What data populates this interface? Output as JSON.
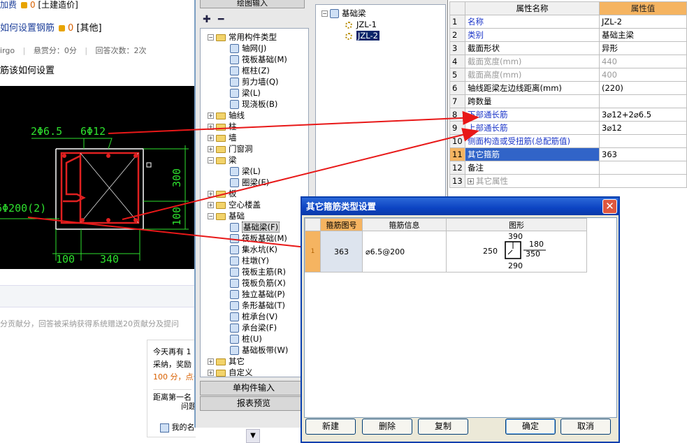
{
  "web": {
    "line1_text": "加费",
    "line1_count": "0",
    "line1_tag": "[土建造价]",
    "line2_link": "如何设置钢筋",
    "line2_count": "0",
    "line2_tag": "[其他]",
    "meta_user": "irgo",
    "meta_bounty": "悬赏分：0分",
    "meta_answers": "回答次数：2次",
    "question": "筋该如何设置",
    "cad_labels": [
      "2Φ6.5",
      "6Φ12",
      "6Φ200(2)",
      "300",
      "100",
      "100",
      "340"
    ],
    "note": "分贡献分，回答被采纳获得系统赠送20贡献分及提问",
    "box_lines": [
      "今天再有 1",
      "采纳，奖励",
      "100 分，点击"
    ],
    "box_lines2": [
      "距离第一名",
      "问题"
    ],
    "box_footer": "我的名",
    "scroll_glyph": "▼"
  },
  "app": {
    "draw_input_tab": "绘图输入",
    "toolbar": {
      "add_icon": "✚",
      "remove_icon": "━"
    },
    "tree": [
      {
        "label": "常用构件类型",
        "kind": "folder",
        "pm": "-"
      },
      {
        "label": "轴网(J)",
        "kind": "item"
      },
      {
        "label": "筏板基础(M)",
        "kind": "item"
      },
      {
        "label": "框柱(Z)",
        "kind": "item"
      },
      {
        "label": "剪力墙(Q)",
        "kind": "item"
      },
      {
        "label": "梁(L)",
        "kind": "item"
      },
      {
        "label": "现浇板(B)",
        "kind": "item"
      },
      {
        "label": "轴线",
        "kind": "folder",
        "pm": "+"
      },
      {
        "label": "柱",
        "kind": "folder",
        "pm": "+"
      },
      {
        "label": "墙",
        "kind": "folder",
        "pm": "+"
      },
      {
        "label": "门窗洞",
        "kind": "folder",
        "pm": "+"
      },
      {
        "label": "梁",
        "kind": "folder",
        "pm": "-"
      },
      {
        "label": "梁(L)",
        "kind": "item"
      },
      {
        "label": "圈梁(E)",
        "kind": "item"
      },
      {
        "label": "板",
        "kind": "folder",
        "pm": "+"
      },
      {
        "label": "空心楼盖",
        "kind": "folder",
        "pm": "+"
      },
      {
        "label": "基础",
        "kind": "folder",
        "pm": "-"
      },
      {
        "label": "基础梁(F)",
        "kind": "item",
        "selected": true
      },
      {
        "label": "筏板基础(M)",
        "kind": "item"
      },
      {
        "label": "集水坑(K)",
        "kind": "item"
      },
      {
        "label": "柱墩(Y)",
        "kind": "item"
      },
      {
        "label": "筏板主筋(R)",
        "kind": "item"
      },
      {
        "label": "筏板负筋(X)",
        "kind": "item"
      },
      {
        "label": "独立基础(P)",
        "kind": "item"
      },
      {
        "label": "条形基础(T)",
        "kind": "item"
      },
      {
        "label": "桩承台(V)",
        "kind": "item"
      },
      {
        "label": "承台梁(F)",
        "kind": "item"
      },
      {
        "label": "桩(U)",
        "kind": "item"
      },
      {
        "label": "基础板带(W)",
        "kind": "item"
      },
      {
        "label": "其它",
        "kind": "folder",
        "pm": "+"
      },
      {
        "label": "自定义",
        "kind": "folder",
        "pm": "+"
      }
    ],
    "btn_single": "单构件输入",
    "btn_report": "报表预览",
    "mid_tree": {
      "root": "基础梁",
      "children": [
        "JZL-1",
        "JZL-2"
      ]
    },
    "props": {
      "col_name": "属性名称",
      "col_value": "属性值",
      "rows": [
        {
          "n": "1",
          "name": "名称",
          "value": "JZL-2",
          "style": "blue"
        },
        {
          "n": "2",
          "name": "类别",
          "value": "基础主梁",
          "style": "blue"
        },
        {
          "n": "3",
          "name": "截面形状",
          "value": "异形",
          "style": ""
        },
        {
          "n": "4",
          "name": "截面宽度(mm)",
          "value": "440",
          "style": "grey"
        },
        {
          "n": "5",
          "name": "截面高度(mm)",
          "value": "400",
          "style": "grey"
        },
        {
          "n": "6",
          "name": "轴线距梁左边线距离(mm)",
          "value": "(220)",
          "style": ""
        },
        {
          "n": "7",
          "name": "跨数量",
          "value": "",
          "style": ""
        },
        {
          "n": "8",
          "name": "下部通长筋",
          "value": "3⌀12+2⌀6.5",
          "style": "blue"
        },
        {
          "n": "9",
          "name": "上部通长筋",
          "value": "3⌀12",
          "style": "blue"
        },
        {
          "n": "10",
          "name": "侧面构造或受扭筋(总配筋值)",
          "value": "",
          "style": "blue"
        },
        {
          "n": "11",
          "name": "其它箍筋",
          "value": "363",
          "style": "sel"
        },
        {
          "n": "12",
          "name": "备注",
          "value": "",
          "style": ""
        },
        {
          "n": "13",
          "name": "其它属性",
          "value": "",
          "style": "grey",
          "pm": "+"
        }
      ]
    }
  },
  "dialog": {
    "title": "其它箍筋类型设置",
    "close_glyph": "✕",
    "headers": [
      "箍筋图号",
      "箍筋信息",
      "图形"
    ],
    "row": {
      "n": "1",
      "code": "363",
      "info": "⌀6.5@200",
      "dims": {
        "left": "250",
        "top": "390",
        "right_top": "180",
        "right_bottom": "350",
        "bottom": "290"
      }
    },
    "buttons": {
      "new": "新建",
      "delete": "删除",
      "copy": "复制",
      "ok": "确定",
      "cancel": "取消"
    }
  },
  "colors": {
    "arrow": "#e81818",
    "title_bar": "#0c43c2",
    "header_highlight": "#f5b461",
    "cad_bg": "#000000",
    "cad_line": "#2ee02e",
    "cad_rebar": "#e02020"
  }
}
